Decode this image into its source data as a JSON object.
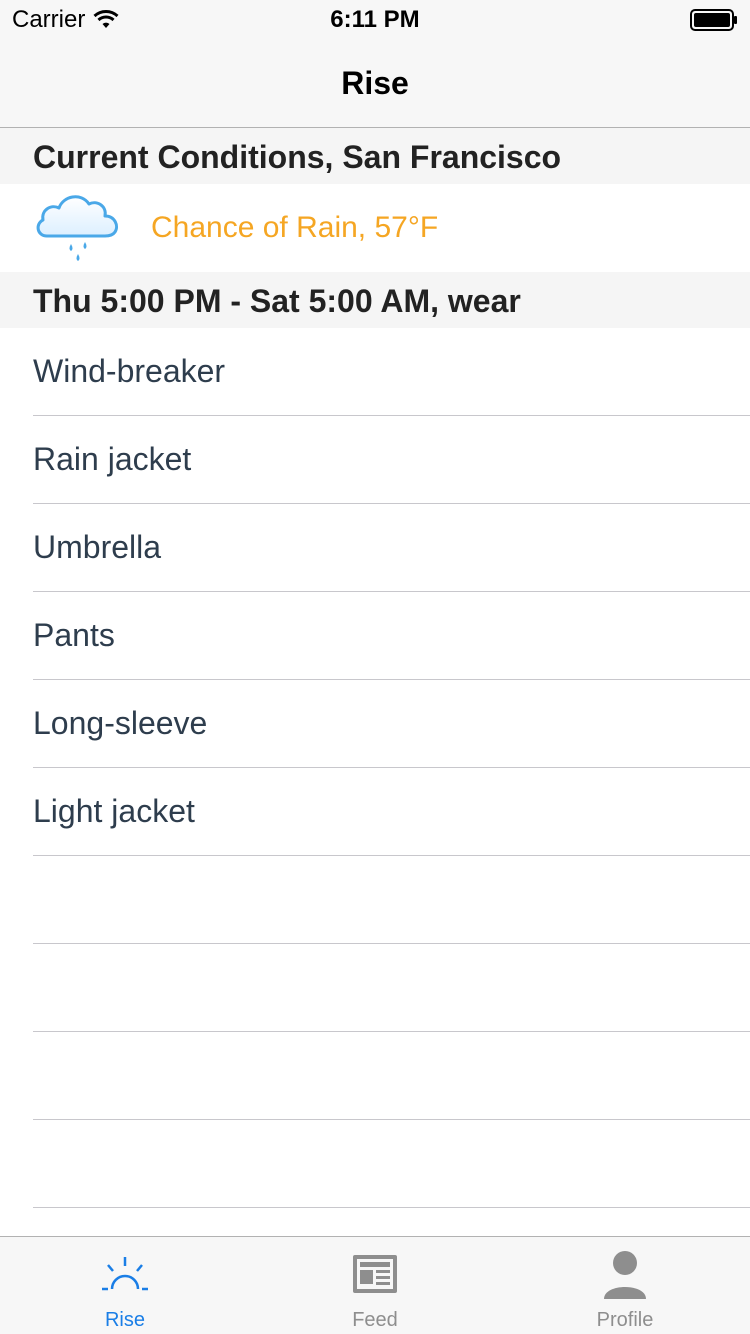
{
  "status_bar": {
    "carrier": "Carrier",
    "time": "6:11 PM"
  },
  "nav": {
    "title": "Rise"
  },
  "conditions": {
    "header": "Current Conditions, San Francisco",
    "weather_icon": "rain-cloud-icon",
    "summary": "Chance of Rain, 57°F",
    "summary_color": "#f5a623"
  },
  "wear": {
    "header": "Thu 5:00 PM - Sat 5:00 AM, wear",
    "items": [
      "Wind-breaker",
      "Rain jacket",
      "Umbrella",
      "Pants",
      "Long-sleeve",
      "Light jacket",
      "",
      "",
      "",
      ""
    ]
  },
  "tabs": [
    {
      "label": "Rise",
      "icon": "sunrise-icon",
      "active": true
    },
    {
      "label": "Feed",
      "icon": "newspaper-icon",
      "active": false
    },
    {
      "label": "Profile",
      "icon": "person-icon",
      "active": false
    }
  ],
  "colors": {
    "accent": "#1a7ee6",
    "list_text": "#2e3d4d",
    "inactive_tab": "#8e8e8e"
  }
}
